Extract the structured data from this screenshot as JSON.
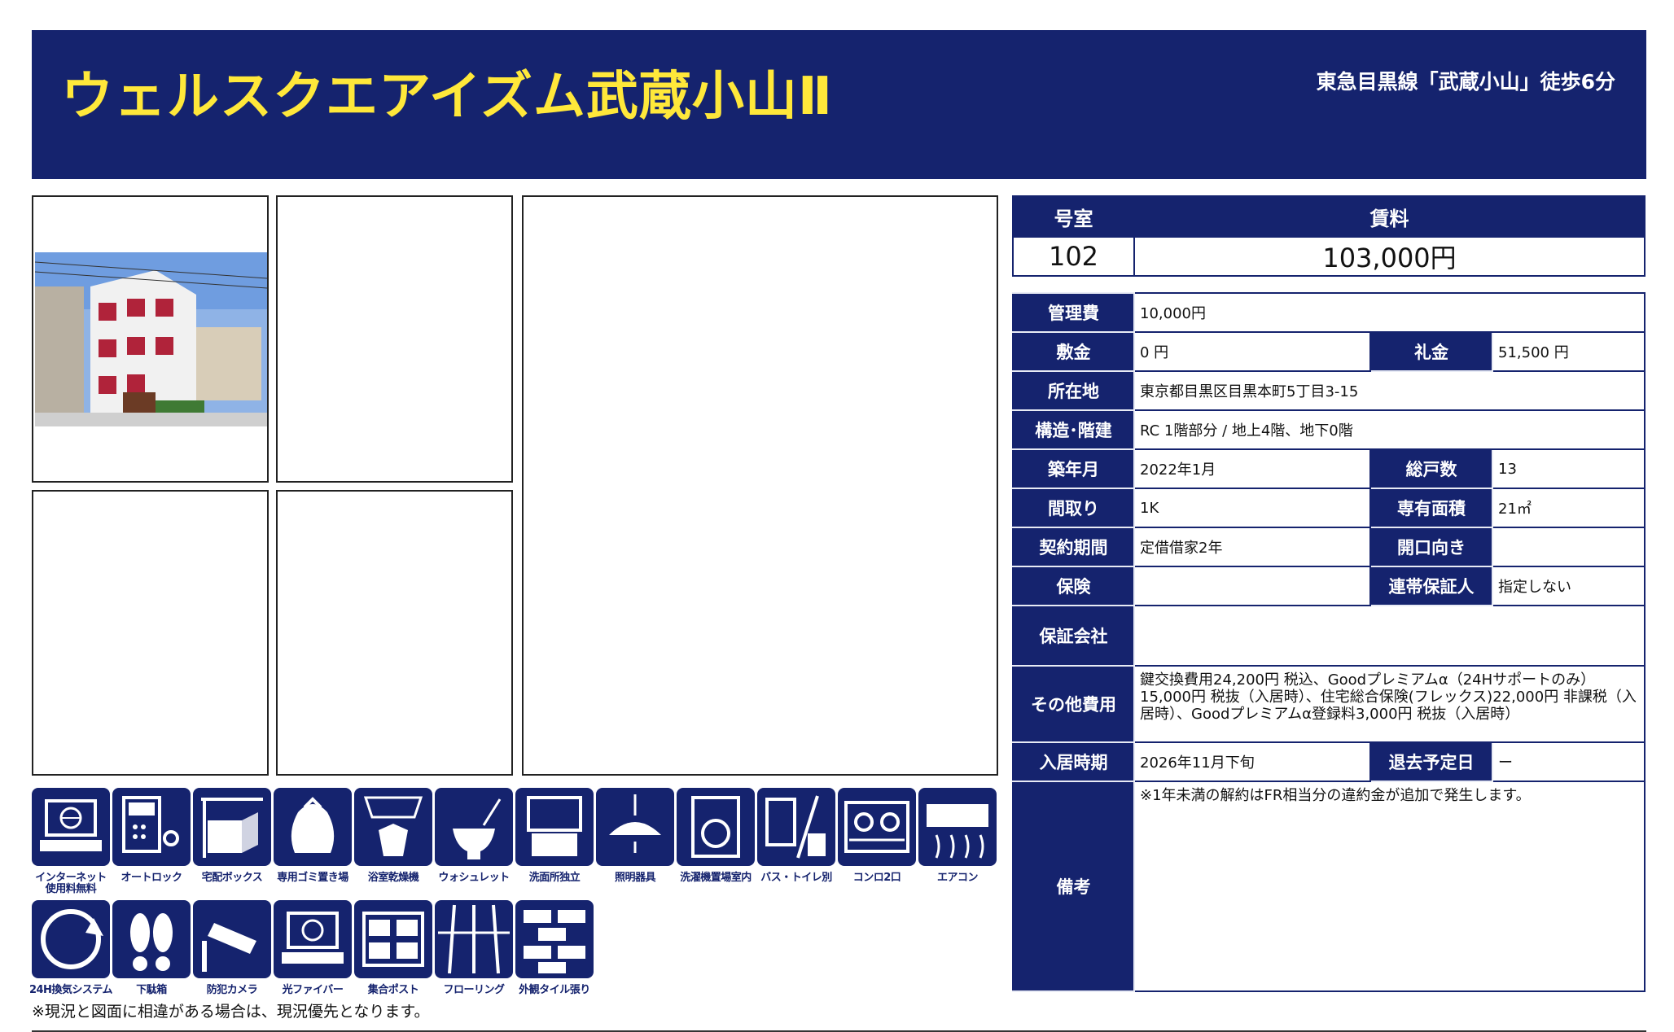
{
  "header": {
    "title": "ウェルスクエアイズム武蔵小山Ⅱ",
    "station": "東急目黒線「武蔵小山」徒歩6分",
    "background": "#15236e",
    "title_color": "#ffe83a"
  },
  "rent_table": {
    "room_label": "号室",
    "rent_label": "賃料",
    "room": "102",
    "rent": "103,000円"
  },
  "info": {
    "management_fee_label": "管理費",
    "management_fee": "10,000円",
    "deposit_label": "敷金",
    "deposit": "0 円",
    "key_money_label": "礼金",
    "key_money": "51,500 円",
    "address_label": "所在地",
    "address": "東京都目黒区目黒本町5丁目3-15",
    "structure_label": "構造･階建",
    "structure": "RC 1階部分 / 地上4階、地下0階",
    "built_label": "築年月",
    "built": "2022年1月",
    "units_label": "総戸数",
    "units": "13",
    "layout_label": "間取り",
    "layout": "1K",
    "area_label": "専有面積",
    "area": "21㎡",
    "contract_label": "契約期間",
    "contract": "定借借家2年",
    "facing_label": "開口向き",
    "facing": "",
    "insurance_label": "保険",
    "insurance": "",
    "guarantor_label": "連帯保証人",
    "guarantor": "指定しない",
    "guarantee_company_label": "保証会社",
    "guarantee_company": "",
    "other_fees_label": "その他費用",
    "other_fees": "鍵交換費用24,200円 税込、Goodプレミアムα（24Hサポートのみ）15,000円 税抜（入居時）、住宅総合保険(フレックス)22,000円 非課税（入居時）、Goodプレミアムα登録料3,000円 税抜（入居時）",
    "move_in_label": "入居時期",
    "move_in": "2026年11月下旬",
    "move_out_label": "退去予定日",
    "move_out": "ー",
    "remarks_label": "備考",
    "remarks": "※1年未満の解約はFR相当分の違約金が追加で発生します。"
  },
  "amenities_row1": [
    {
      "label": "インターネット\n使用料無料",
      "icon": "internet-free-icon"
    },
    {
      "label": "オートロック",
      "icon": "auto-lock-icon"
    },
    {
      "label": "宅配ボックス",
      "icon": "delivery-box-icon"
    },
    {
      "label": "専用ゴミ置き場",
      "icon": "garbage-area-icon"
    },
    {
      "label": "浴室乾燥機",
      "icon": "bath-dryer-icon"
    },
    {
      "label": "ウォシュレット",
      "icon": "washlet-icon"
    },
    {
      "label": "洗面所独立",
      "icon": "washroom-icon"
    },
    {
      "label": "照明器具",
      "icon": "lighting-icon"
    },
    {
      "label": "洗濯機置場室内",
      "icon": "washing-machine-icon"
    },
    {
      "label": "バス・トイレ別",
      "icon": "bath-toilet-separate-icon"
    },
    {
      "label": "コンロ2口",
      "icon": "stove-icon"
    },
    {
      "label": "エアコン",
      "icon": "air-conditioner-icon"
    }
  ],
  "amenities_row2": [
    {
      "label": "24H換気システム",
      "icon": "ventilation-24h-icon"
    },
    {
      "label": "下駄箱",
      "icon": "shoe-box-icon"
    },
    {
      "label": "防犯カメラ",
      "icon": "security-camera-icon"
    },
    {
      "label": "光ファイバー",
      "icon": "optical-fiber-icon"
    },
    {
      "label": "集合ポスト",
      "icon": "mailbox-icon"
    },
    {
      "label": "フローリング",
      "icon": "flooring-icon"
    },
    {
      "label": "外観タイル張り",
      "icon": "tile-exterior-icon"
    }
  ],
  "notice": "※現況と図面に相違がある場合は、現況優先となります。"
}
